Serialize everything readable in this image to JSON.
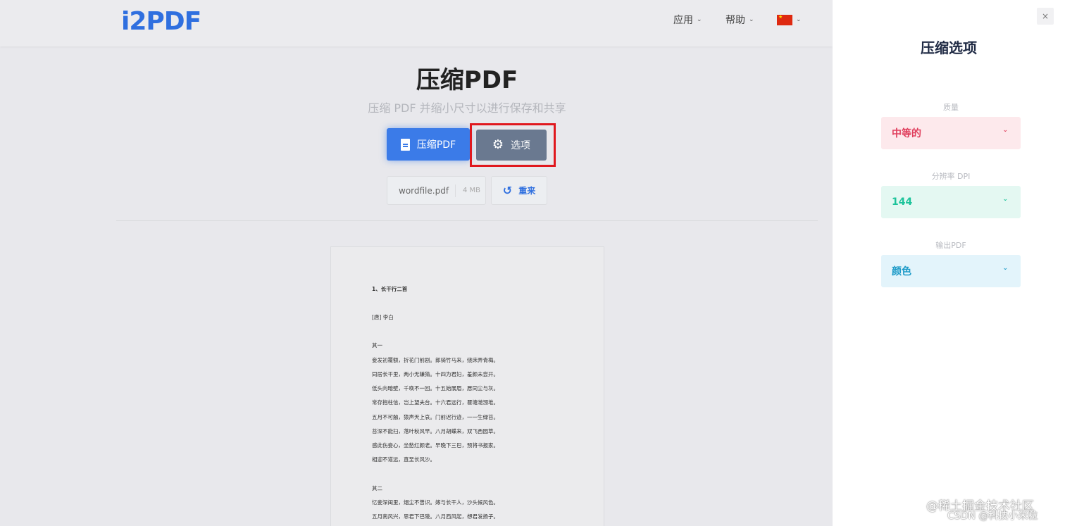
{
  "header": {
    "logo": "i2PDF",
    "nav": [
      {
        "label": "应用"
      },
      {
        "label": "帮助"
      }
    ],
    "language": "CN"
  },
  "main": {
    "title": "压缩PDF",
    "subtitle": "压缩 PDF 并缩小尺寸以进行保存和共享",
    "compress_button": "压缩PDF",
    "options_button": "选项",
    "file": {
      "name": "wordfile.pdf",
      "size": "4 MB"
    },
    "reset_button": "重来"
  },
  "document_preview": {
    "lines": [
      "1、长干行二首",
      "[唐] 李白",
      "其一",
      "妾发初覆额，折花门前剧。郎骑竹马来，绕床弄青梅。",
      "同居长干里，两小无嫌猜。十四为君妇，羞颜未尝开。",
      "低头向暗壁，千唤不一回。十五始展眉，愿同尘与灰。",
      "常存抱柱信，岂上望夫台。十六君远行，瞿塘滟滪堆。",
      "五月不可触，猿声天上哀。门前迟行迹，一一生绿苔。",
      "苔深不能扫，落叶秋风早。八月胡蝶来，双飞西园草。",
      "感此伤妾心，坐愁红颜老。早晚下三巴，预将书报家。",
      "相迎不道远，直至长风沙。",
      "其二",
      "忆妾深闺里，烟尘不曾识。嫁与长干人，沙头候风色。",
      "五月南风兴，思君下巴陵。八月西风起，想君发扬子。"
    ]
  },
  "panel": {
    "title": "压缩选项",
    "close": "×",
    "fields": [
      {
        "label": "质量",
        "value": "中等的"
      },
      {
        "label": "分辨率 DPI",
        "value": "144"
      },
      {
        "label": "输出PDF",
        "value": "颜色"
      }
    ]
  },
  "watermark": {
    "line1": "@稀土掘金技术社区",
    "line2": "CSDN @科技小米粒"
  },
  "colors": {
    "accent": "#3b7be8",
    "options_button": "#6a7990",
    "highlight": "#e0181e",
    "quality": "#e0405e",
    "dpi": "#1cc39a",
    "output": "#1e9bc8"
  }
}
